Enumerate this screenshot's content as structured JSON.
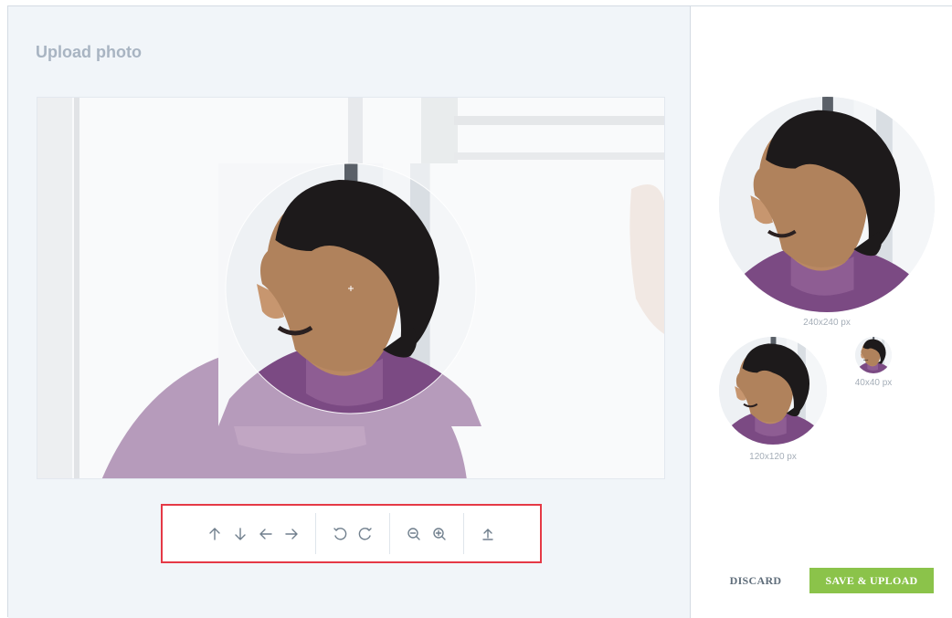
{
  "dialog": {
    "title": "Upload photo"
  },
  "toolbar": {
    "groups": [
      {
        "name": "move",
        "buttons": [
          "arrow-up-icon",
          "arrow-down-icon",
          "arrow-left-icon",
          "arrow-right-icon"
        ]
      },
      {
        "name": "rotate",
        "buttons": [
          "rotate-left-icon",
          "rotate-right-icon"
        ]
      },
      {
        "name": "zoom",
        "buttons": [
          "zoom-out-icon",
          "zoom-in-icon"
        ]
      },
      {
        "name": "upload",
        "buttons": [
          "upload-icon"
        ]
      }
    ]
  },
  "previews": {
    "large": {
      "label": "240x240 px"
    },
    "medium": {
      "label": "120x120 px"
    },
    "small": {
      "label": "40x40 px"
    }
  },
  "actions": {
    "discard_label": "DISCARD",
    "save_label": "SAVE & UPLOAD"
  },
  "colors": {
    "accent": "#8bc34a",
    "highlight_border": "#e53946",
    "pane_background": "#f1f5f9"
  }
}
